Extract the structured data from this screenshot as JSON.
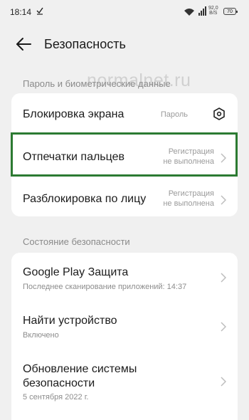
{
  "status_bar": {
    "time": "18:14",
    "network_speed_value": "92,0",
    "network_speed_unit": "B/S",
    "battery": "70"
  },
  "header": {
    "title": "Безопасность"
  },
  "watermark": "normalnet.ru",
  "section_password": {
    "label": "Пароль и биометрические данные",
    "items": [
      {
        "title": "Блокировка экрана",
        "value": "Пароль"
      },
      {
        "title": "Отпечатки пальцев",
        "value_line1": "Регистрация",
        "value_line2": "не выполнена"
      },
      {
        "title": "Разблокировка по лицу",
        "value_line1": "Регистрация",
        "value_line2": "не выполнена"
      }
    ]
  },
  "section_status": {
    "label": "Состояние безопасности",
    "items": [
      {
        "title": "Google Play Защита",
        "subtitle": "Последнее сканирование приложений: 14:37"
      },
      {
        "title": "Найти устройство",
        "subtitle": "Включено"
      },
      {
        "title_line1": "Обновление системы",
        "title_line2": "безопасности",
        "subtitle": "5 сентября 2022 г."
      }
    ]
  },
  "colors": {
    "background": "#f0f0f0",
    "card": "#ffffff",
    "highlight": "#2c7a32"
  }
}
